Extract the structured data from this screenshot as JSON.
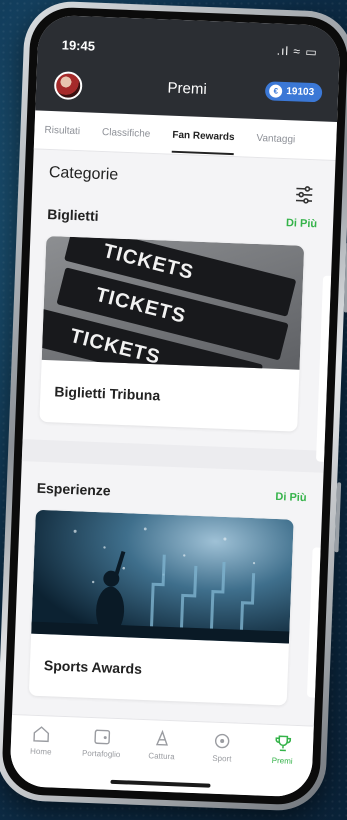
{
  "status_bar": {
    "time": "19:45",
    "icons": ".ıl ≈ ▭"
  },
  "header": {
    "title": "Premi",
    "coins": "19103"
  },
  "tabs": [
    {
      "label": "Risultati"
    },
    {
      "label": "Classifiche"
    },
    {
      "label": "Fan Rewards",
      "active": true
    },
    {
      "label": "Vantaggi"
    }
  ],
  "categories": {
    "title": "Categorie"
  },
  "groups": [
    {
      "title": "Biglietti",
      "more": "Di Più",
      "card_label": "Biglietti Tribuna",
      "ticket_text": "TICKETS"
    },
    {
      "title": "Esperienze",
      "more": "Di Più",
      "card_label": "Sports Awards"
    }
  ],
  "bottom_nav": [
    {
      "label": "Home",
      "icon": "home-icon"
    },
    {
      "label": "Portafoglio",
      "icon": "wallet-icon"
    },
    {
      "label": "Cattura",
      "icon": "capture-icon"
    },
    {
      "label": "Sport",
      "icon": "ball-icon"
    },
    {
      "label": "Premi",
      "icon": "trophy-icon",
      "active": true
    }
  ],
  "colors": {
    "accent_green": "#35b34a",
    "header_dark": "#2b2e33",
    "coin_blue": "#3b78d6"
  }
}
